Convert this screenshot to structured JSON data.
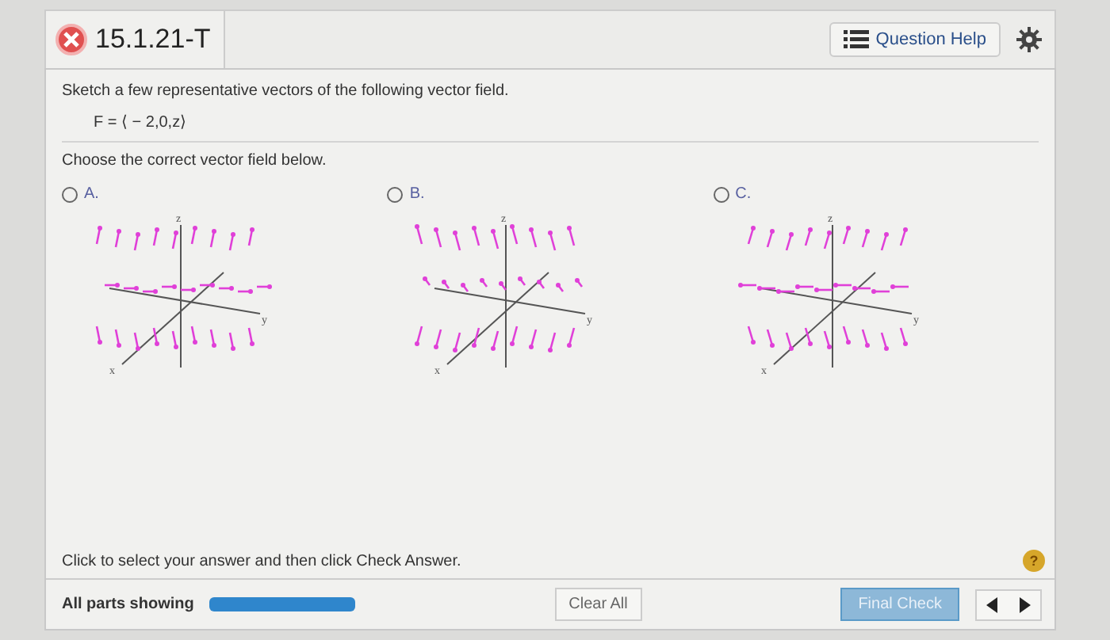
{
  "header": {
    "title": "15.1.21-T",
    "incorrect": true,
    "help_button": "Question Help"
  },
  "question": {
    "prompt": "Sketch a few representative vectors of the following vector field.",
    "formula": "F = ⟨ − 2,0,z⟩",
    "instruction": "Choose the correct vector field below."
  },
  "options": [
    {
      "label": "A.",
      "selected": false,
      "axes": {
        "z": "z",
        "x": "x",
        "y": "y"
      }
    },
    {
      "label": "B.",
      "selected": false,
      "axes": {
        "z": "z",
        "x": "x",
        "y": "y"
      }
    },
    {
      "label": "C.",
      "selected": false,
      "axes": {
        "z": "z",
        "x": "x",
        "y": "y"
      }
    }
  ],
  "footer": {
    "hint": "Click to select your answer and then click Check Answer.",
    "help_badge": "?",
    "parts_label": "All parts showing",
    "progress": {
      "level": 1
    },
    "clear_button": "Clear All",
    "final_button": "Final Check",
    "disabled_final": true
  }
}
